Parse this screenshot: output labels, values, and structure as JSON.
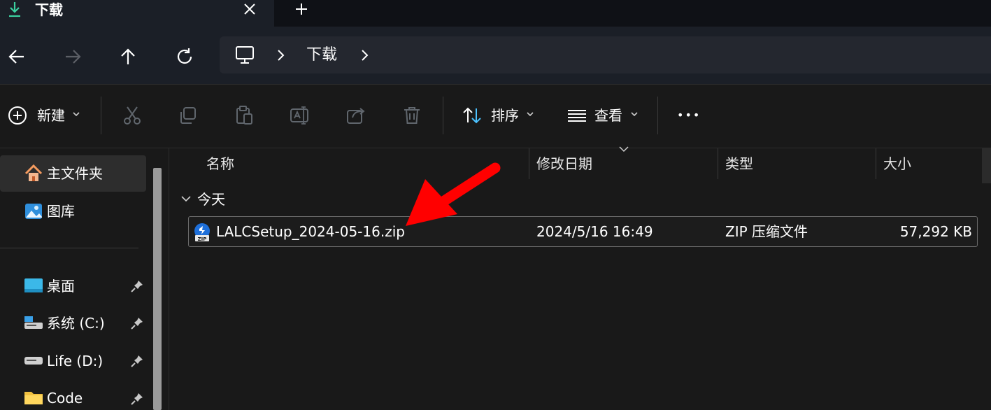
{
  "tab": {
    "title": "下载",
    "close_glyph": "✕",
    "new_tab_glyph": "+"
  },
  "nav": {
    "back": "back-arrow-icon",
    "forward": "forward-arrow-icon",
    "up": "up-arrow-icon",
    "refresh": "refresh-icon"
  },
  "address": {
    "segments": [
      "下载"
    ]
  },
  "toolbar": {
    "new_label": "新建",
    "sort_label": "排序",
    "view_label": "查看",
    "more_glyph": "•••"
  },
  "sidebar": {
    "pinned_top": [
      {
        "label": "主文件夹",
        "icon": "home-icon"
      },
      {
        "label": "图库",
        "icon": "gallery-icon"
      }
    ],
    "quick_access": [
      {
        "label": "桌面",
        "icon": "desktop-icon"
      },
      {
        "label": "系统 (C:)",
        "icon": "drive-icon"
      },
      {
        "label": "Life (D:)",
        "icon": "drive-icon"
      },
      {
        "label": "Code",
        "icon": "folder-icon"
      }
    ]
  },
  "columns": {
    "name": "名称",
    "modified": "修改日期",
    "type": "类型",
    "size": "大小"
  },
  "group": {
    "label": "今天"
  },
  "files": [
    {
      "name": "LALCSetup_2024-05-16.zip",
      "modified": "2024/5/16 16:49",
      "type": "ZIP 压缩文件",
      "size": "57,292 KB"
    }
  ],
  "colors": {
    "accent": "#4cc2ff",
    "annotation_arrow": "#ff0000",
    "background": "#191919"
  }
}
